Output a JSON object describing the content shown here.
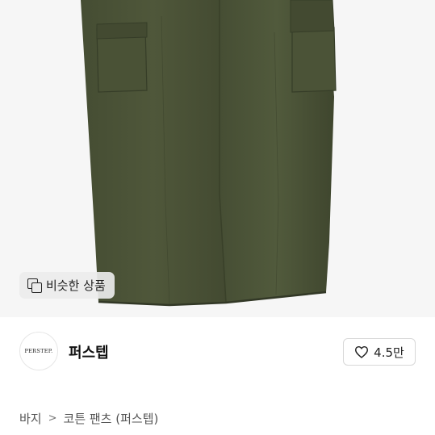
{
  "similar_button": {
    "label": "비슷한 상품",
    "icon": "similar-items-icon"
  },
  "shop": {
    "logo_text": "PERSTEP.",
    "name": "퍼스텝"
  },
  "like": {
    "count": "4.5만",
    "icon": "heart-icon"
  },
  "breadcrumb": {
    "category": "바지",
    "separator": ">",
    "product": "코튼 팬츠 (퍼스텝)"
  },
  "colors": {
    "pants": "#4a5236",
    "background": "#f6f6f6"
  }
}
